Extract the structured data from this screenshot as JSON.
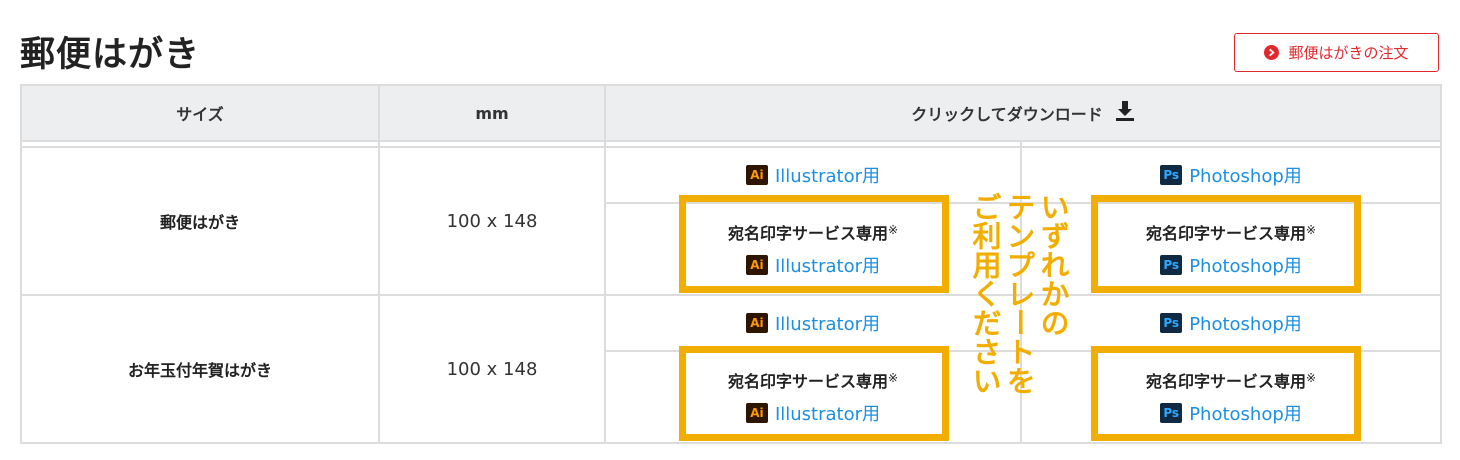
{
  "page": {
    "title": "郵便はがき"
  },
  "order_button": {
    "label": "郵便はがきの注文",
    "icon": "chevron-right-circle-icon"
  },
  "table": {
    "headers": {
      "size": "サイズ",
      "mm": "mm",
      "download": "クリックしてダウンロード"
    },
    "rows": [
      {
        "name": "郵便はがき",
        "mm": "100 x 148",
        "illustrator": "Illustrator用",
        "photoshop": "Photoshop用",
        "addr_title": "宛名印字サービス専用",
        "addr_mark": "※",
        "addr_illustrator": "Illustrator用",
        "addr_photoshop": "Photoshop用"
      },
      {
        "name": "お年玉付年賀はがき",
        "mm": "100 x 148",
        "illustrator": "Illustrator用",
        "photoshop": "Photoshop用",
        "addr_title": "宛名印字サービス専用",
        "addr_mark": "※",
        "addr_illustrator": "Illustrator用",
        "addr_photoshop": "Photoshop用"
      }
    ]
  },
  "badges": {
    "ai": "Ai",
    "ps": "Ps"
  },
  "annotation": {
    "col1": "いずれかの",
    "col2": "テンプレートを",
    "col3": "ご利用ください"
  },
  "colors": {
    "accent_red": "#e0282d",
    "highlight": "#f2ae00",
    "link": "#1d8fe2",
    "header_bg": "#eceeef"
  }
}
